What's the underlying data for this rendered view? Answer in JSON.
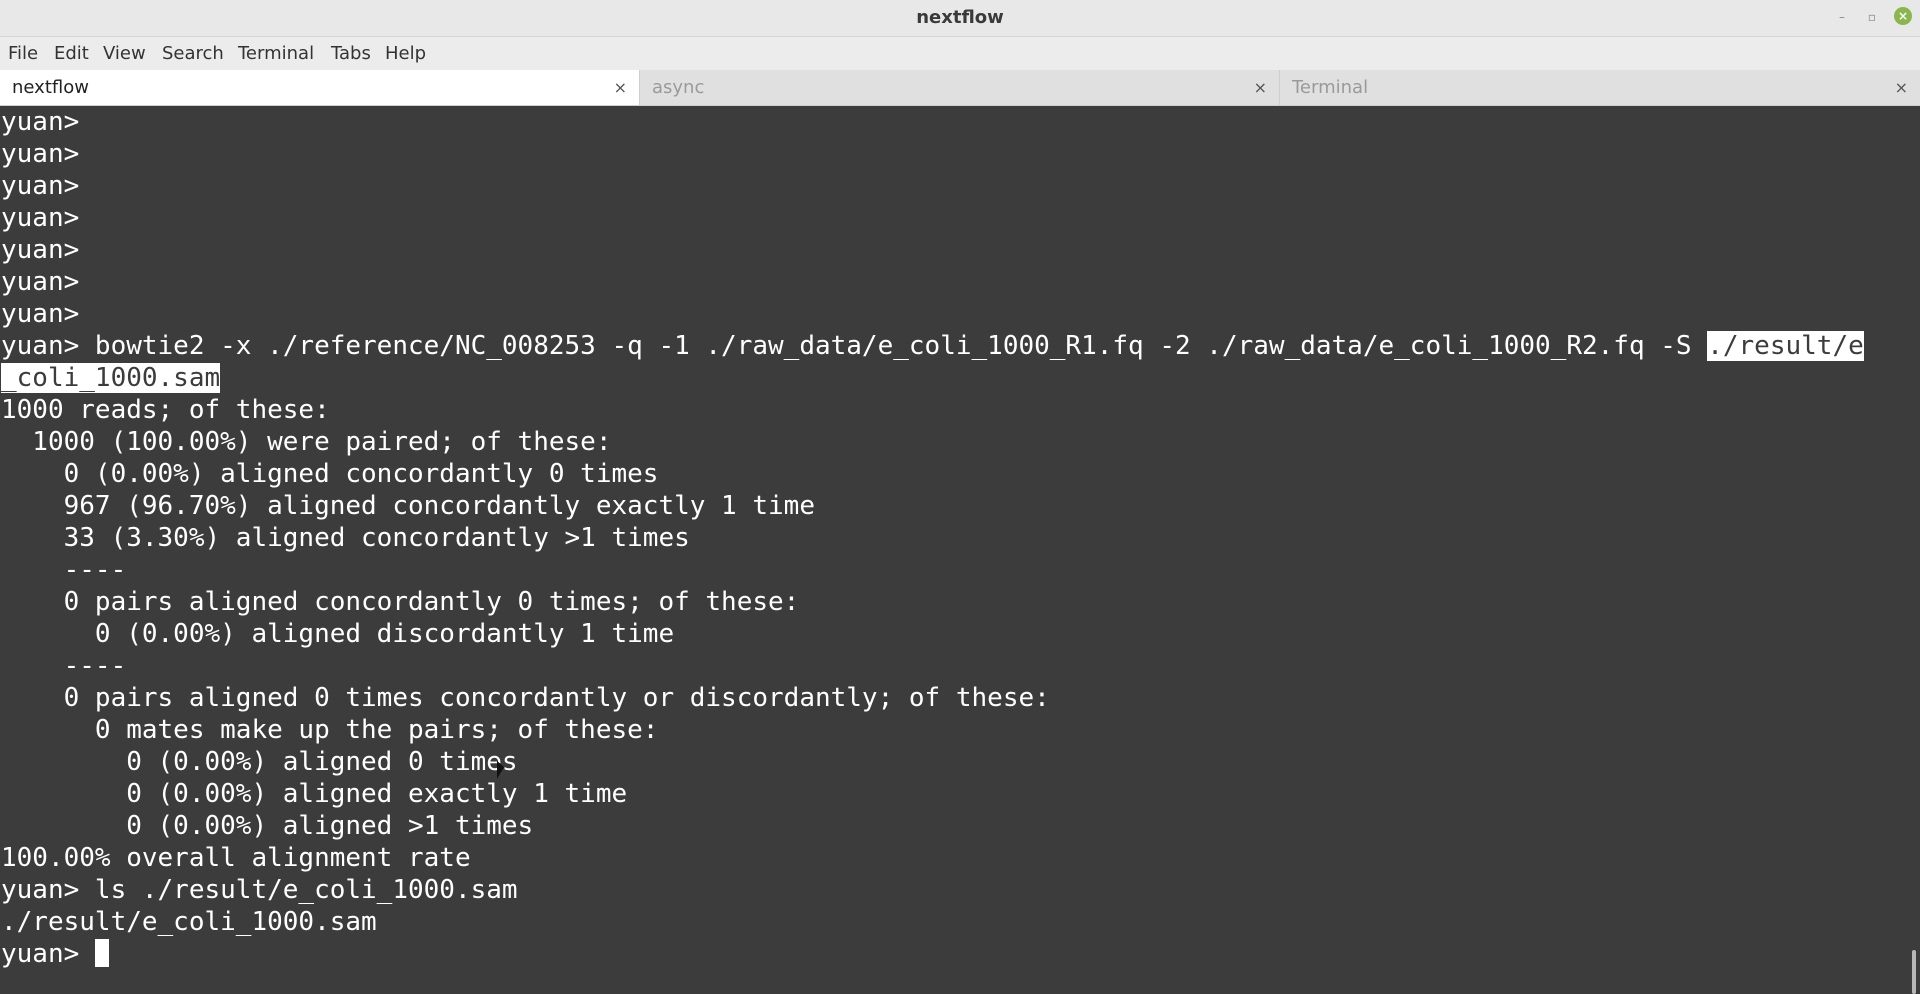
{
  "window": {
    "title": "nextflow",
    "minimize_glyph": "–",
    "maximize_glyph": "▫",
    "close_glyph": "×"
  },
  "menu": [
    "File",
    "Edit",
    "View",
    "Search",
    "Terminal",
    "Tabs",
    "Help"
  ],
  "tabs": [
    {
      "label": "nextflow",
      "close": "×",
      "active": true
    },
    {
      "label": "async",
      "close": "×",
      "active": false
    },
    {
      "label": "Terminal",
      "close": "×",
      "active": false
    }
  ],
  "terminal": {
    "lines": [
      "yuan>",
      "yuan>",
      "yuan>",
      "yuan>",
      "yuan>",
      "yuan>",
      "yuan>",
      "yuan> bowtie2 -x ./reference/NC_008253 -q -1 ./raw_data/e_coli_1000_R1.fq -2 ./raw_data/e_coli_1000_R2.fq -S ",
      "",
      "1000 reads; of these:",
      "  1000 (100.00%) were paired; of these:",
      "    0 (0.00%) aligned concordantly 0 times",
      "    967 (96.70%) aligned concordantly exactly 1 time",
      "    33 (3.30%) aligned concordantly >1 times",
      "    ----",
      "    0 pairs aligned concordantly 0 times; of these:",
      "      0 (0.00%) aligned discordantly 1 time",
      "    ----",
      "    0 pairs aligned 0 times concordantly or discordantly; of these:",
      "      0 mates make up the pairs; of these:",
      "        0 (0.00%) aligned 0 times",
      "        0 (0.00%) aligned exactly 1 time",
      "        0 (0.00%) aligned >1 times",
      "100.00% overall alignment rate",
      "yuan> ls ./result/e_coli_1000.sam",
      "./result/e_coli_1000.sam",
      "yuan> "
    ],
    "selection_part1": "./result/e",
    "selection_part2": "_coli_1000.sam"
  }
}
